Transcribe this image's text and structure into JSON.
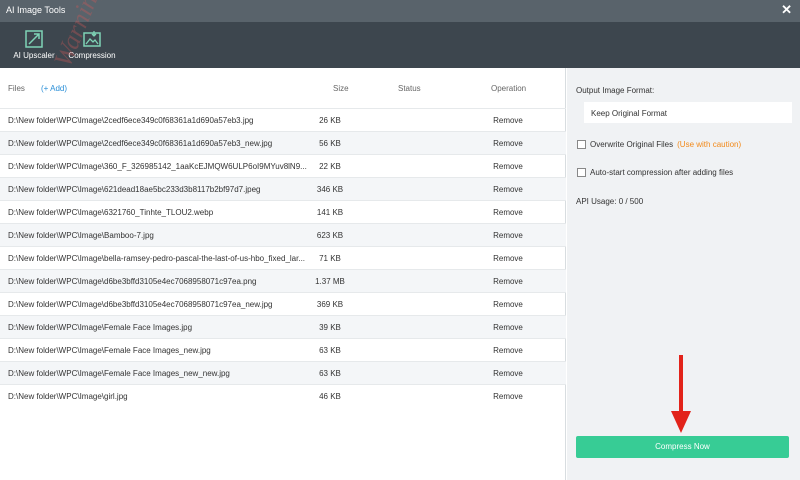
{
  "window": {
    "title": "AI Image Tools",
    "close_glyph": "✕"
  },
  "toolbar": {
    "tools": [
      {
        "label": "AI Upscaler",
        "icon": "upscale-icon"
      },
      {
        "label": "Compression",
        "icon": "compression-icon"
      }
    ]
  },
  "watermark": "WarningPC",
  "list": {
    "headers": {
      "files": "Files",
      "add": "(+ Add)",
      "size": "Size",
      "status": "Status",
      "operation": "Operation"
    },
    "rows": [
      {
        "file": "D:\\New folder\\WPC\\Image\\2cedf6ece349c0f68361a1d690a57eb3.jpg",
        "size": "26 KB",
        "status": "",
        "operation": "Remove"
      },
      {
        "file": "D:\\New folder\\WPC\\Image\\2cedf6ece349c0f68361a1d690a57eb3_new.jpg",
        "size": "56 KB",
        "status": "",
        "operation": "Remove"
      },
      {
        "file": "D:\\New folder\\WPC\\Image\\360_F_326985142_1aaKcEJMQW6ULP6oI9MYuv8lN9...",
        "size": "22 KB",
        "status": "",
        "operation": "Remove"
      },
      {
        "file": "D:\\New folder\\WPC\\Image\\621dead18ae5bc233d3b8117b2bf97d7.jpeg",
        "size": "346 KB",
        "status": "",
        "operation": "Remove"
      },
      {
        "file": "D:\\New folder\\WPC\\Image\\6321760_Tinhte_TLOU2.webp",
        "size": "141 KB",
        "status": "",
        "operation": "Remove"
      },
      {
        "file": "D:\\New folder\\WPC\\Image\\Bamboo-7.jpg",
        "size": "623 KB",
        "status": "",
        "operation": "Remove"
      },
      {
        "file": "D:\\New folder\\WPC\\Image\\bella-ramsey-pedro-pascal-the-last-of-us-hbo_fixed_lar...",
        "size": "71 KB",
        "status": "",
        "operation": "Remove"
      },
      {
        "file": "D:\\New folder\\WPC\\Image\\d6be3bffd3105e4ec7068958071c97ea.png",
        "size": "1.37 MB",
        "status": "",
        "operation": "Remove"
      },
      {
        "file": "D:\\New folder\\WPC\\Image\\d6be3bffd3105e4ec7068958071c97ea_new.jpg",
        "size": "369 KB",
        "status": "",
        "operation": "Remove"
      },
      {
        "file": "D:\\New folder\\WPC\\Image\\Female Face Images.jpg",
        "size": "39 KB",
        "status": "",
        "operation": "Remove"
      },
      {
        "file": "D:\\New folder\\WPC\\Image\\Female Face Images_new.jpg",
        "size": "63 KB",
        "status": "",
        "operation": "Remove"
      },
      {
        "file": "D:\\New folder\\WPC\\Image\\Female Face Images_new_new.jpg",
        "size": "63 KB",
        "status": "",
        "operation": "Remove"
      },
      {
        "file": "D:\\New folder\\WPC\\Image\\girl.jpg",
        "size": "46 KB",
        "status": "",
        "operation": "Remove"
      }
    ]
  },
  "settings": {
    "output_format_label": "Output Image Format:",
    "output_format_value": "Keep Original Format",
    "overwrite_label": "Overwrite Original Files",
    "overwrite_caution": "(Use with caution)",
    "overwrite_checked": false,
    "autostart_label": "Auto-start compression after adding files",
    "autostart_checked": false,
    "api_usage": "API Usage: 0 / 500",
    "compress_button": "Compress Now"
  },
  "colors": {
    "titlebar": "#59636b",
    "toolbar": "#3d464e",
    "accent_green": "#37cc95",
    "link_blue": "#2a8fd8",
    "caution_orange": "#f28a1b",
    "annotation_arrow": "#e2231a"
  }
}
